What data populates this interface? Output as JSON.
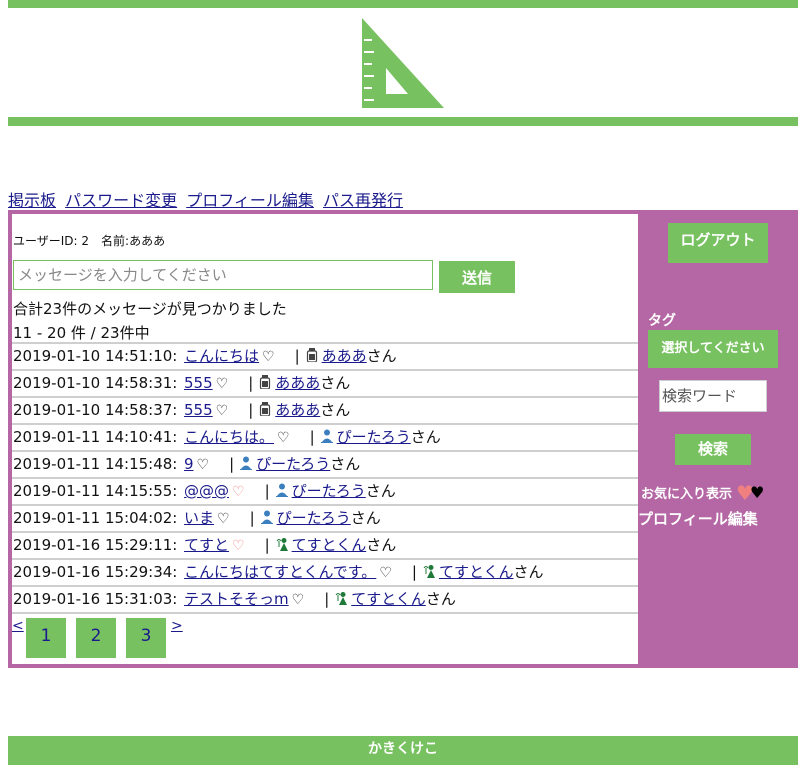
{
  "nav": [
    "掲示板",
    "パスワード変更",
    "プロフィール編集",
    "パス再発行"
  ],
  "user_info": "ユーザーID: 2　名前:あああ",
  "message_input": {
    "placeholder": "メッセージを入力してください"
  },
  "send_label": "送信",
  "total_text": "合計23件のメッセージが見つかりました",
  "range_text": "11 - 20 件 / 23件中",
  "messages": [
    {
      "time": "2019-01-10 14:51:10:",
      "text": "こんにちは",
      "fav": false,
      "user": "あああ",
      "icon": "bottle-icon"
    },
    {
      "time": "2019-01-10 14:58:31:",
      "text": "555",
      "fav": false,
      "user": "あああ",
      "icon": "bottle-icon"
    },
    {
      "time": "2019-01-10 14:58:37:",
      "text": "555",
      "fav": false,
      "user": "あああ",
      "icon": "bottle-icon"
    },
    {
      "time": "2019-01-11 14:10:41:",
      "text": "こんにちは。",
      "fav": false,
      "user": "ぴーたろう",
      "icon": "person-icon"
    },
    {
      "time": "2019-01-11 14:15:48:",
      "text": "9",
      "fav": false,
      "user": "ぴーたろう",
      "icon": "person-icon"
    },
    {
      "time": "2019-01-11 14:15:55:",
      "text": "@@@",
      "fav": true,
      "user": "ぴーたろう",
      "icon": "person-icon"
    },
    {
      "time": "2019-01-11 15:04:02:",
      "text": "いま",
      "fav": false,
      "user": "ぴーたろう",
      "icon": "person-icon"
    },
    {
      "time": "2019-01-16 15:29:11:",
      "text": "てすと",
      "fav": true,
      "user": "てすとくん",
      "icon": "plant-icon"
    },
    {
      "time": "2019-01-16 15:29:34:",
      "text": "こんにちはてすとくんです。",
      "fav": false,
      "user": "てすとくん",
      "icon": "plant-icon"
    },
    {
      "time": "2019-01-16 15:31:03:",
      "text": "テストそそっm",
      "fav": false,
      "user": "てすとくん",
      "icon": "plant-icon"
    }
  ],
  "san_suffix": "さん",
  "pager": {
    "prev": "<",
    "next": ">",
    "pages": [
      "1",
      "2",
      "3"
    ]
  },
  "sidebar": {
    "logout": "ログアウト",
    "tag_label": "タグ",
    "tag_select": "選択してください",
    "search_placeholder": "検索ワード",
    "search_button": "検索",
    "favorites": "お気に入り表示",
    "profile_edit": "プロフィール編集"
  },
  "footer": "かきくけこ",
  "colors": {
    "accent_green": "#77c160",
    "panel_purple": "#b467a4",
    "fav_heart": "#f08080"
  },
  "icons": {
    "logo": "triangle-ruler-icon",
    "heart": "heart-icon"
  }
}
